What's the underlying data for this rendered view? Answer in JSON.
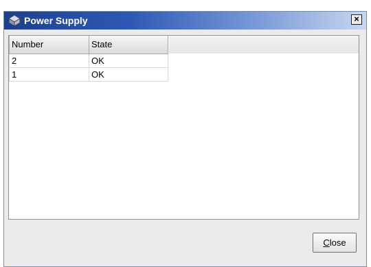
{
  "window": {
    "title": "Power Supply",
    "close_glyph": "×"
  },
  "table": {
    "columns": [
      "Number",
      "State"
    ],
    "rows": [
      {
        "number": "2",
        "state": "OK"
      },
      {
        "number": "1",
        "state": "OK"
      }
    ]
  },
  "footer": {
    "close_label": "Close",
    "close_mnemonic": "C",
    "close_rest": "lose"
  },
  "icons": {
    "title_icon": "power-supply-icon",
    "close_icon": "close-icon"
  },
  "colors": {
    "titlebar_start": "#1d3f8d",
    "titlebar_end": "#c9d6ef",
    "window_bg": "#ecebe9"
  }
}
